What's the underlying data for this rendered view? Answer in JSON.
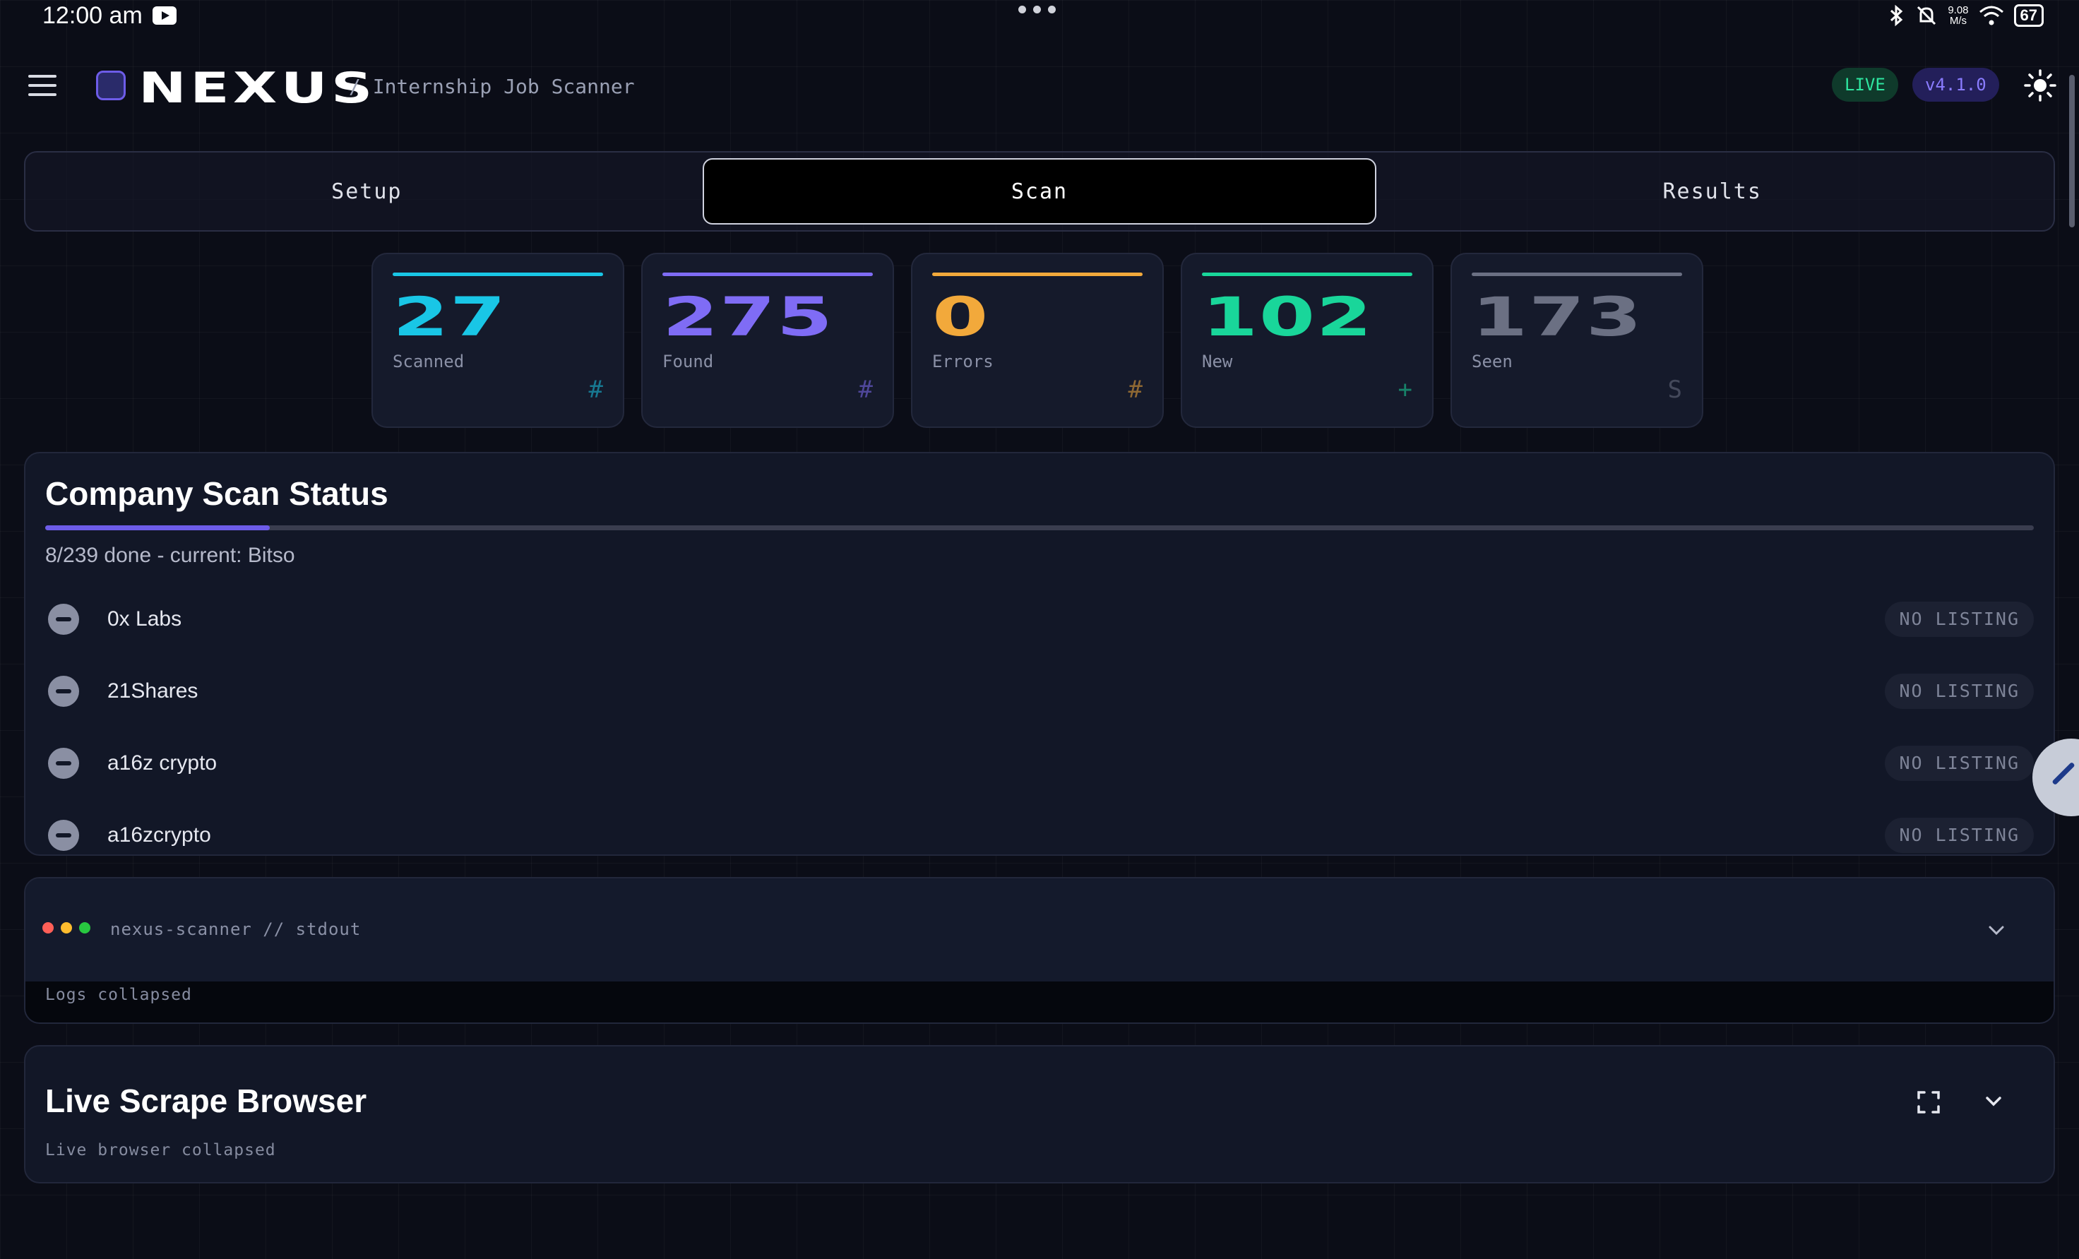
{
  "status_bar": {
    "time": "12:00 am",
    "net_speed_top": "9.08",
    "net_speed_unit": "M/s",
    "battery": "67"
  },
  "header": {
    "brand": "NEXUS",
    "breadcrumb": "/ Internship Job Scanner",
    "live_label": "LIVE",
    "version": "v4.1.0"
  },
  "tabs": [
    {
      "label": "Setup"
    },
    {
      "label": "Scan"
    },
    {
      "label": "Results"
    }
  ],
  "active_tab": "Scan",
  "stats": [
    {
      "value": "27",
      "label": "Scanned",
      "symbol": "#",
      "color": "#19c6e6"
    },
    {
      "value": "275",
      "label": "Found",
      "symbol": "#",
      "color": "#7f6cf5"
    },
    {
      "value": "0",
      "label": "Errors",
      "symbol": "#",
      "color": "#f2a93b"
    },
    {
      "value": "102",
      "label": "New",
      "symbol": "+",
      "color": "#19d69a"
    },
    {
      "value": "173",
      "label": "Seen",
      "symbol": "S",
      "color": "#6b7083"
    }
  ],
  "company_scan": {
    "title": "Company Scan Status",
    "progress_fraction": 0.113,
    "done_text": "8/239 done - current: Bitso",
    "rows": [
      {
        "name": "0x Labs",
        "tag": "NO LISTING"
      },
      {
        "name": "21Shares",
        "tag": "NO LISTING"
      },
      {
        "name": "a16z crypto",
        "tag": "NO LISTING"
      },
      {
        "name": "a16zcrypto",
        "tag": "NO LISTING"
      }
    ]
  },
  "log_panel": {
    "title": "nexus-scanner // stdout",
    "body": "Logs collapsed",
    "dot_colors": [
      "#ff5f57",
      "#febc2e",
      "#28c840"
    ]
  },
  "browser_panel": {
    "title": "Live Scrape Browser",
    "body": "Live browser collapsed"
  },
  "colors": {
    "accent": "#6d5ce8",
    "live_green": "#2ee6a0",
    "background": "#0b0d17"
  }
}
